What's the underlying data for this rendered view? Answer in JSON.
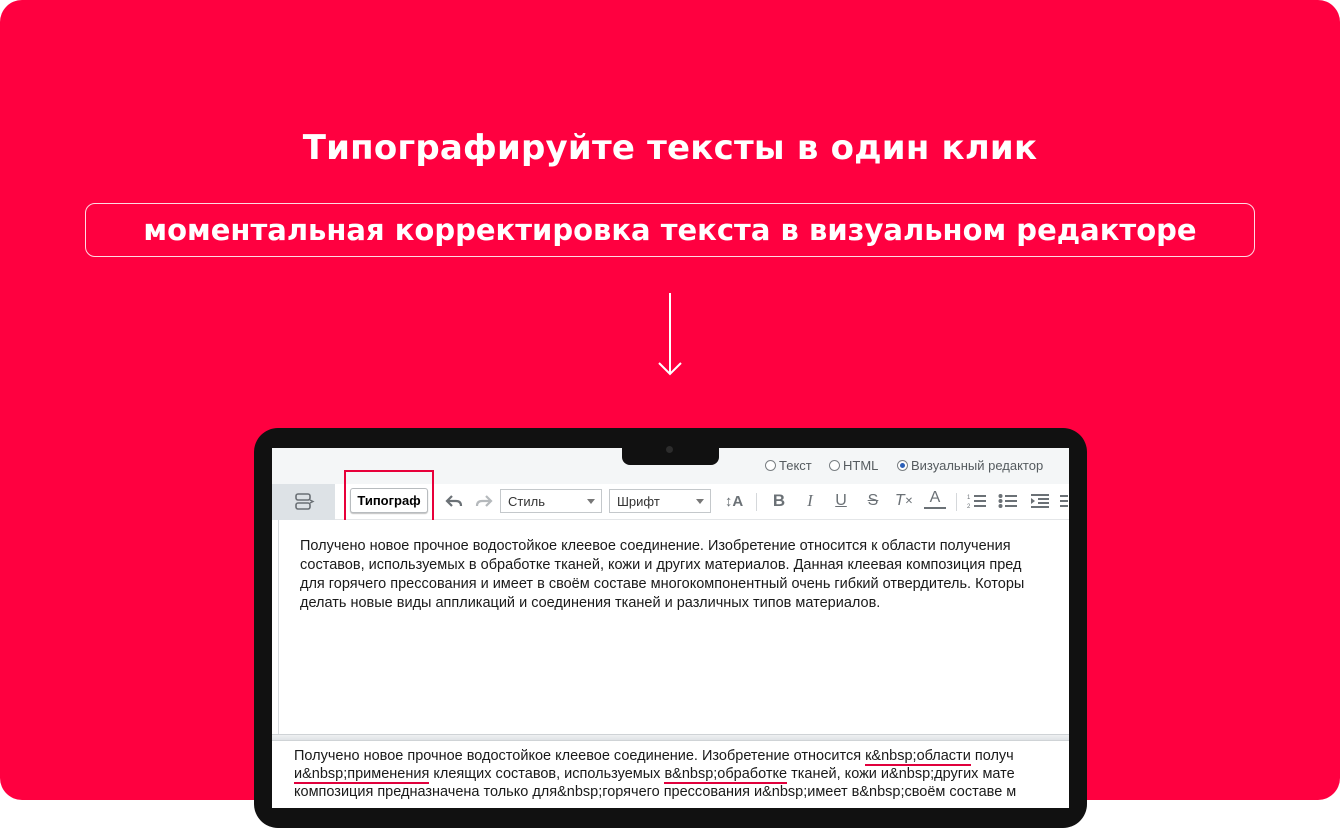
{
  "banner": {
    "background": "#ff0040",
    "headline": "Типографируйте тексты в один клик",
    "subtitle": "моментальная корректировка текста в визуальном редакторе"
  },
  "editor_ui": {
    "modes": [
      {
        "label": "Текст",
        "checked": false
      },
      {
        "label": "HTML",
        "checked": false
      },
      {
        "label": "Визуальный редактор",
        "checked": true
      }
    ],
    "toolbar": {
      "typograf_label": "Типограф",
      "style_select": "Стиль",
      "font_select": "Шрифт",
      "icons": [
        "undo-icon",
        "redo-icon",
        "font-size-icon",
        "bold-icon",
        "italic-icon",
        "underline-icon",
        "strikethrough-icon",
        "clear-format-icon",
        "text-color-icon",
        "ordered-list-icon",
        "unordered-list-icon",
        "indent-icon"
      ]
    },
    "visual_text": {
      "line1": "Получено новое прочное водостойкое клеевое соединение. Изобретение относится к области получения",
      "line2": "составов, используемых в обработке тканей, кожи и других материалов. Данная клеевая композиция пред",
      "line3": "для горячего прессования и имеет в своём составе многокомпонентный очень гибкий отвердитель. Которы",
      "line4": "делать новые виды аппликаций и соединения тканей и различных типов материалов."
    },
    "html_text": {
      "l1_a": "Получено новое прочное водостойкое клеевое соединение. Изобретение относится ",
      "l1_u": "к&nbsp;области",
      "l1_b": " получ",
      "l2_u1": "и&nbsp;применения",
      "l2_a": " клеящих составов, используемых ",
      "l2_u2": "в&nbsp;обработке",
      "l2_b": " тканей, кожи и&nbsp;других мате",
      "l3": "композиция предназначена только для&nbsp;горячего прессования и&nbsp;имеет в&nbsp;своём составе м"
    }
  }
}
